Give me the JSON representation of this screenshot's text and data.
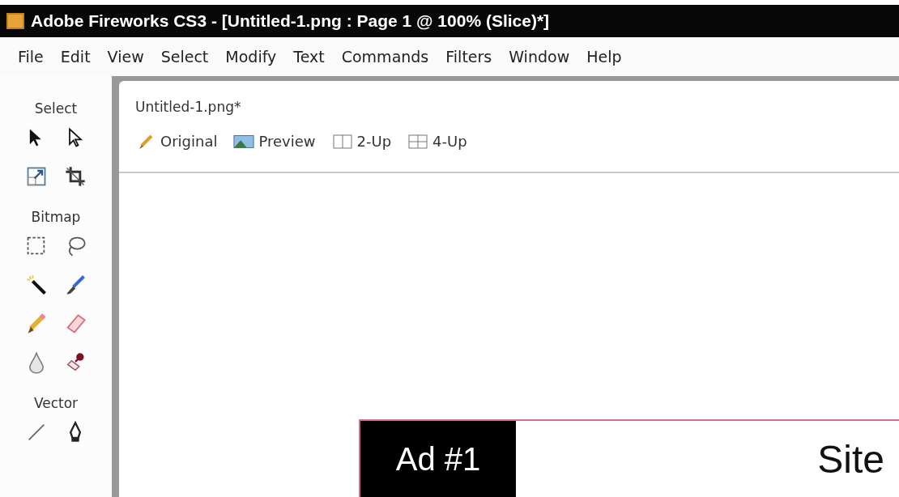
{
  "window": {
    "title": "Adobe Fireworks CS3 - [Untitled-1.png : Page 1 @ 100% (Slice)*]"
  },
  "menu": [
    "File",
    "Edit",
    "View",
    "Select",
    "Modify",
    "Text",
    "Commands",
    "Filters",
    "Window",
    "Help"
  ],
  "tool_groups": [
    {
      "title": "Select"
    },
    {
      "title": "Bitmap"
    },
    {
      "title": "Vector"
    }
  ],
  "document": {
    "tab": "Untitled-1.png*",
    "views": [
      "Original",
      "Preview",
      "2-Up",
      "4-Up"
    ]
  },
  "canvas": {
    "ad_label": "Ad #1",
    "site_text": "Site"
  }
}
